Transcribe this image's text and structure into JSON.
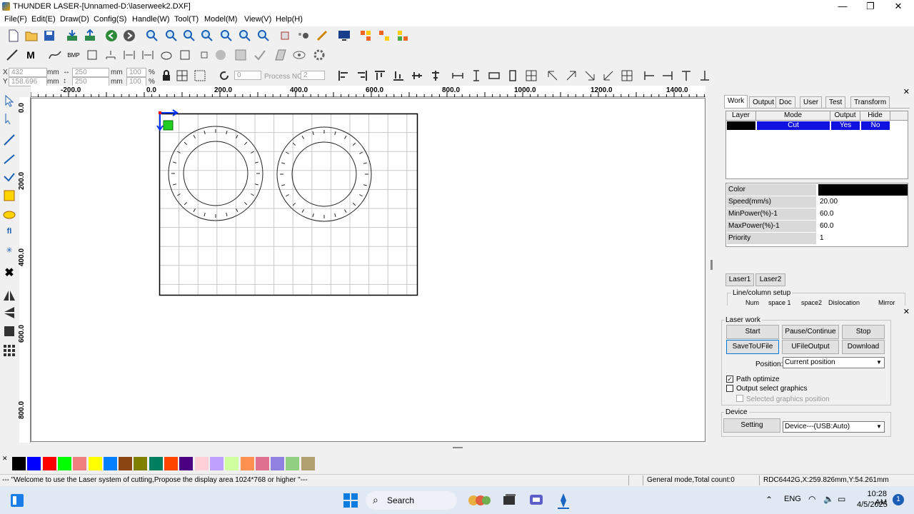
{
  "window": {
    "title": "THUNDER LASER-[Unnamed-D:\\laserweek2.DXF]",
    "minimize": "—",
    "maximize": "❐",
    "close": "✕"
  },
  "menu": [
    "File(F)",
    "Edit(E)",
    "Draw(D)",
    "Config(S)",
    "Handle(W)",
    "Tool(T)",
    "Model(M)",
    "View(V)",
    "Help(H)"
  ],
  "coords": {
    "x_label": "X",
    "x_value": "432",
    "y_label": "Y",
    "y_value": "158.696",
    "unit": "mm",
    "w_value": "250",
    "h_value": "250",
    "pct_w": "100",
    "pct_h": "100",
    "pct": "%",
    "rotate_value": "0",
    "process_label": "Process NO:",
    "process_value": "2"
  },
  "ruler_top": [
    "-200.0",
    "0.0",
    "200.0",
    "400.0",
    "600.0",
    "800.0",
    "1000.0",
    "1200.0",
    "1400.0"
  ],
  "ruler_left": [
    "0.0",
    "200.0",
    "400.0",
    "600.0",
    "800.0"
  ],
  "right_panel": {
    "tabs": [
      "Work",
      "Output",
      "Doc",
      "User",
      "Test",
      "Transform"
    ],
    "layer_headers": [
      "Layer",
      "Mode",
      "Output",
      "Hide"
    ],
    "layer_row": {
      "mode": "Cut",
      "output": "Yes",
      "hide": "No"
    },
    "layer_colors": {
      "swatch": "#000000",
      "row_bg": "#0000cc"
    },
    "props": [
      {
        "key": "Color",
        "value": ""
      },
      {
        "key": "Speed(mm/s)",
        "value": "20.00"
      },
      {
        "key": "MinPower(%)-1",
        "value": "60.0"
      },
      {
        "key": "MaxPower(%)-1",
        "value": "60.0"
      },
      {
        "key": "Priority",
        "value": "1"
      }
    ],
    "laser_tabs": [
      "Laser1",
      "Laser2"
    ],
    "line_column_title": "Line/column setup",
    "line_column_headers": [
      "Num",
      "space 1",
      "space2",
      "Dislocation",
      "Mirror"
    ]
  },
  "laser_work": {
    "title": "Laser work",
    "buttons": [
      "Start",
      "Pause/Continue",
      "Stop",
      "SaveToUFile",
      "UFileOutput",
      "Download"
    ],
    "position_label": "Position:",
    "position_value": "Current position",
    "path_optimize": "Path optimize",
    "output_select": "Output select graphics",
    "selected_pos": "Selected graphics position"
  },
  "device": {
    "title": "Device",
    "setting": "Setting",
    "device_value": "Device---(USB:Auto)"
  },
  "palette": [
    "#000000",
    "#0000ff",
    "#ff0000",
    "#00ff00",
    "#f08080",
    "#ffff00",
    "#0080ff",
    "#8b4513",
    "#808000",
    "#008060",
    "#ff4500",
    "#4b0082",
    "#ffd0d8",
    "#c0a0ff",
    "#d0ffa0",
    "#ff9050",
    "#e07090",
    "#9080e0",
    "#90d080",
    "#b0a070"
  ],
  "status": {
    "left": "--- \"Welcome to use the Laser system of cutting,Propose the display area 1024*768 or higher \"---",
    "mode": "General mode,Total count:0",
    "device": "RDC6442G,X:259.826mm,Y:54.261mm"
  },
  "taskbar": {
    "search": "Search",
    "lang": "ENG",
    "time": "10:28 AM",
    "date": "4/5/2025",
    "notif": "1"
  }
}
